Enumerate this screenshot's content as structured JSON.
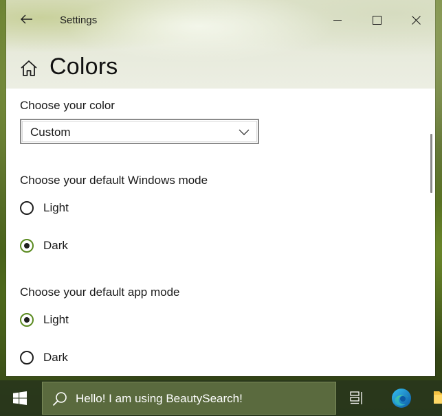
{
  "window": {
    "app_title": "Settings",
    "page_title": "Colors"
  },
  "sections": {
    "choose_color": {
      "label": "Choose your color",
      "selected": "Custom"
    },
    "windows_mode": {
      "label": "Choose your default Windows mode",
      "options": [
        {
          "label": "Light",
          "checked": false
        },
        {
          "label": "Dark",
          "checked": true
        }
      ]
    },
    "app_mode": {
      "label": "Choose your default app mode",
      "options": [
        {
          "label": "Light",
          "checked": true
        },
        {
          "label": "Dark",
          "checked": false
        }
      ]
    }
  },
  "taskbar": {
    "search_text": "Hello! I am using BeautySearch!"
  },
  "colors": {
    "accent": "#5a8a1f"
  },
  "icons": {
    "back": "back-arrow-icon",
    "home": "home-icon",
    "minimize": "minimize-icon",
    "maximize": "maximize-icon",
    "close": "close-icon",
    "chevron": "chevron-down-icon",
    "start": "windows-logo-icon",
    "search": "search-icon",
    "task_view": "task-view-icon",
    "edge": "edge-icon",
    "explorer": "file-explorer-icon"
  }
}
